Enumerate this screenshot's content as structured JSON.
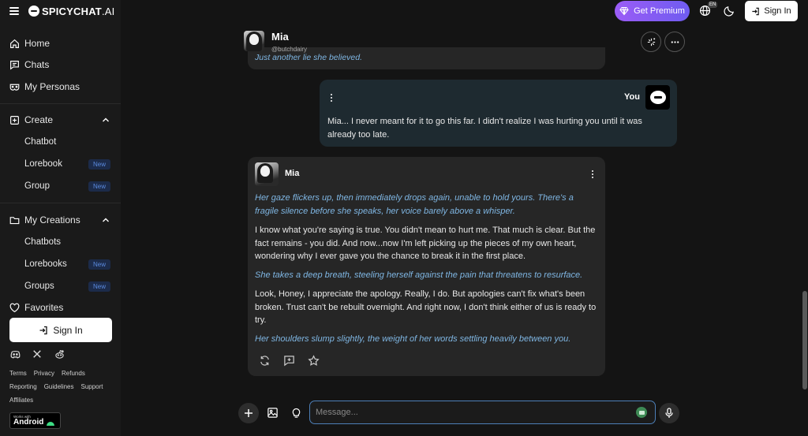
{
  "brand": {
    "name_main": "SPICYCHAT",
    "name_suffix": ".AI"
  },
  "sidebar": {
    "nav": [
      {
        "label": "Home",
        "icon": "home-icon"
      },
      {
        "label": "Chats",
        "icon": "chat-icon"
      },
      {
        "label": "My Personas",
        "icon": "mask-icon"
      }
    ],
    "create": {
      "label": "Create",
      "items": [
        {
          "label": "Chatbot",
          "badge": ""
        },
        {
          "label": "Lorebook",
          "badge": "New"
        },
        {
          "label": "Group",
          "badge": "New"
        }
      ]
    },
    "my_creations": {
      "label": "My Creations",
      "items": [
        {
          "label": "Chatbots",
          "badge": ""
        },
        {
          "label": "Lorebooks",
          "badge": "New"
        },
        {
          "label": "Groups",
          "badge": "New"
        }
      ]
    },
    "favorites": "Favorites",
    "sign_in": "Sign In",
    "footer_links_row1": [
      "Terms",
      "Privacy",
      "Refunds"
    ],
    "footer_links_row2": [
      "Reporting",
      "Guidelines",
      "Support"
    ],
    "footer_links_row3": [
      "Affiliates"
    ],
    "android_badge_small": "Works with",
    "android_badge_big": "Android"
  },
  "topbar": {
    "premium": "Get Premium",
    "language": "EN",
    "sign_in": "Sign In"
  },
  "chat": {
    "bot_name": "Mia",
    "bot_handle": "@butchdairy",
    "previous_message_tail": "Just another lie she believed.",
    "user_message": {
      "sender": "You",
      "text": "Mia... I never meant for it to go this far. I didn't realize I was hurting you until it was already too late."
    },
    "bot_message": {
      "sender": "Mia",
      "paragraphs": [
        {
          "kind": "narration",
          "text": "Her gaze flickers up, then immediately drops again, unable to hold yours. There's a fragile silence before she speaks, her voice barely above a whisper."
        },
        {
          "kind": "speech",
          "text": "I know what you're saying is true. You didn't mean to hurt me. That much is clear. But the fact remains - you did. And now...now I'm left picking up the pieces of my own heart, wondering why I ever gave you the chance to break it in the first place."
        },
        {
          "kind": "narration",
          "text": "She takes a deep breath, steeling herself against the pain that threatens to resurface."
        },
        {
          "kind": "speech",
          "text": "Look, Honey, I appreciate the apology. Really, I do. But apologies can't fix what's been broken. Trust can't be rebuilt overnight. And right now, I don't think either of us is ready to try."
        },
        {
          "kind": "narration",
          "text": "Her shoulders slump slightly, the weight of her words settling heavily between you."
        }
      ]
    },
    "composer": {
      "placeholder": "Message..."
    }
  },
  "colors": {
    "accent_narration": "#7fb6e3",
    "premium_gradient_start": "#9b5cf6",
    "premium_gradient_end": "#6f5cf0",
    "user_bubble": "#1e2a30",
    "bot_bubble": "#262626",
    "new_badge_text": "#5b8bdf"
  }
}
